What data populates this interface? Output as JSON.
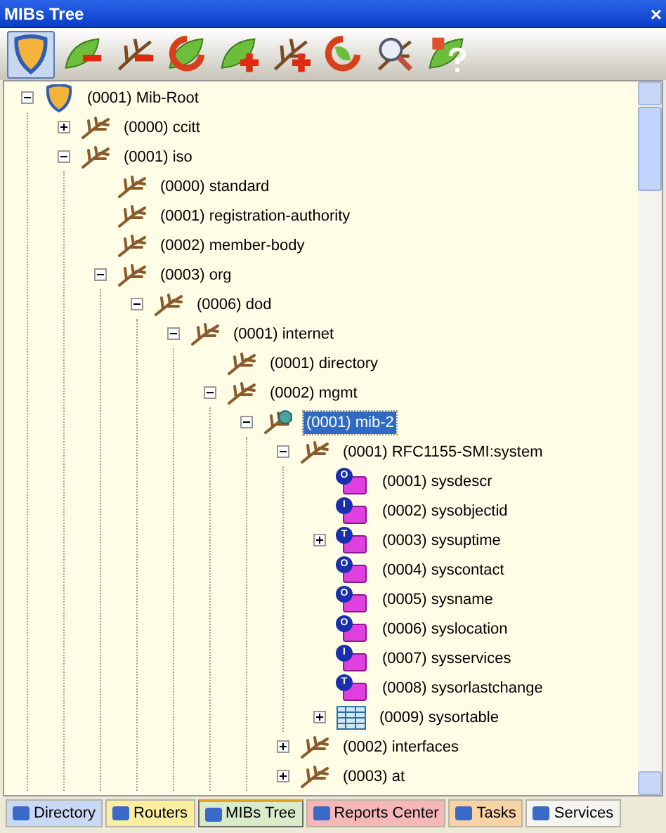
{
  "window": {
    "title": "MIBs Tree",
    "close": "×"
  },
  "toolbar": [
    {
      "kind": "mask",
      "selected": true
    },
    {
      "kind": "leaf-minus",
      "selected": false
    },
    {
      "kind": "branch-minus",
      "selected": false
    },
    {
      "kind": "refresh-leaf",
      "selected": false
    },
    {
      "kind": "leaf-plus",
      "selected": false
    },
    {
      "kind": "branch-plus",
      "selected": false
    },
    {
      "kind": "refresh",
      "selected": false
    },
    {
      "kind": "search",
      "selected": false
    },
    {
      "kind": "help",
      "selected": false
    }
  ],
  "tree": [
    {
      "kind": "root",
      "label": "(0001) Mib-Root",
      "expanded": true,
      "selected": false,
      "children": [
        {
          "kind": "branch",
          "label": "(0000) ccitt",
          "expanded": false,
          "selected": false
        },
        {
          "kind": "branch",
          "label": "(0001) iso",
          "expanded": true,
          "selected": false,
          "children": [
            {
              "kind": "branch",
              "label": "(0000) standard",
              "selected": false
            },
            {
              "kind": "branch",
              "label": "(0001) registration-authority",
              "selected": false
            },
            {
              "kind": "branch",
              "label": "(0002) member-body",
              "selected": false
            },
            {
              "kind": "branch",
              "label": "(0003) org",
              "expanded": true,
              "selected": false,
              "children": [
                {
                  "kind": "branch",
                  "label": "(0006) dod",
                  "expanded": true,
                  "selected": false,
                  "children": [
                    {
                      "kind": "branch",
                      "label": "(0001) internet",
                      "expanded": true,
                      "selected": false,
                      "children": [
                        {
                          "kind": "branch",
                          "label": "(0001) directory",
                          "selected": false
                        },
                        {
                          "kind": "branch",
                          "label": "(0002) mgmt",
                          "expanded": true,
                          "selected": false,
                          "children": [
                            {
                              "kind": "globe",
                              "label": "(0001) mib-2",
                              "expanded": true,
                              "selected": true,
                              "children": [
                                {
                                  "kind": "branch",
                                  "label": "(0001) RFC1155-SMI:system",
                                  "expanded": true,
                                  "selected": false,
                                  "children": [
                                    {
                                      "kind": "scalar",
                                      "badge": "O",
                                      "label": "(0001) sysdescr",
                                      "selected": false
                                    },
                                    {
                                      "kind": "scalar",
                                      "badge": "I",
                                      "label": "(0002) sysobjectid",
                                      "selected": false
                                    },
                                    {
                                      "kind": "scalar",
                                      "badge": "T",
                                      "label": "(0003) sysuptime",
                                      "expanded": false,
                                      "selected": false
                                    },
                                    {
                                      "kind": "scalar",
                                      "badge": "O",
                                      "label": "(0004) syscontact",
                                      "selected": false
                                    },
                                    {
                                      "kind": "scalar",
                                      "badge": "O",
                                      "label": "(0005) sysname",
                                      "selected": false
                                    },
                                    {
                                      "kind": "scalar",
                                      "badge": "O",
                                      "label": "(0006) syslocation",
                                      "selected": false
                                    },
                                    {
                                      "kind": "scalar",
                                      "badge": "I",
                                      "label": "(0007) sysservices",
                                      "selected": false
                                    },
                                    {
                                      "kind": "scalar",
                                      "badge": "T",
                                      "label": "(0008) sysorlastchange",
                                      "selected": false
                                    },
                                    {
                                      "kind": "table",
                                      "label": "(0009) sysortable",
                                      "expanded": false,
                                      "selected": false
                                    }
                                  ]
                                },
                                {
                                  "kind": "branch",
                                  "label": "(0002) interfaces",
                                  "expanded": false,
                                  "selected": false
                                },
                                {
                                  "kind": "branch",
                                  "label": "(0003) at",
                                  "expanded": false,
                                  "selected": false
                                }
                              ]
                            }
                          ]
                        }
                      ]
                    }
                  ]
                }
              ]
            }
          ]
        }
      ]
    }
  ],
  "tabs": [
    {
      "label": "Directory",
      "color": "#c9d9f5",
      "selected": false
    },
    {
      "label": "Routers",
      "color": "#fbeea0",
      "selected": false
    },
    {
      "label": "MIBs Tree",
      "color": "#d9ebc8",
      "selected": true
    },
    {
      "label": "Reports Center",
      "color": "#f6b7b7",
      "selected": false
    },
    {
      "label": "Tasks",
      "color": "#f8d3a6",
      "selected": false
    },
    {
      "label": "Services",
      "color": "#f4f4f0",
      "selected": false
    }
  ]
}
